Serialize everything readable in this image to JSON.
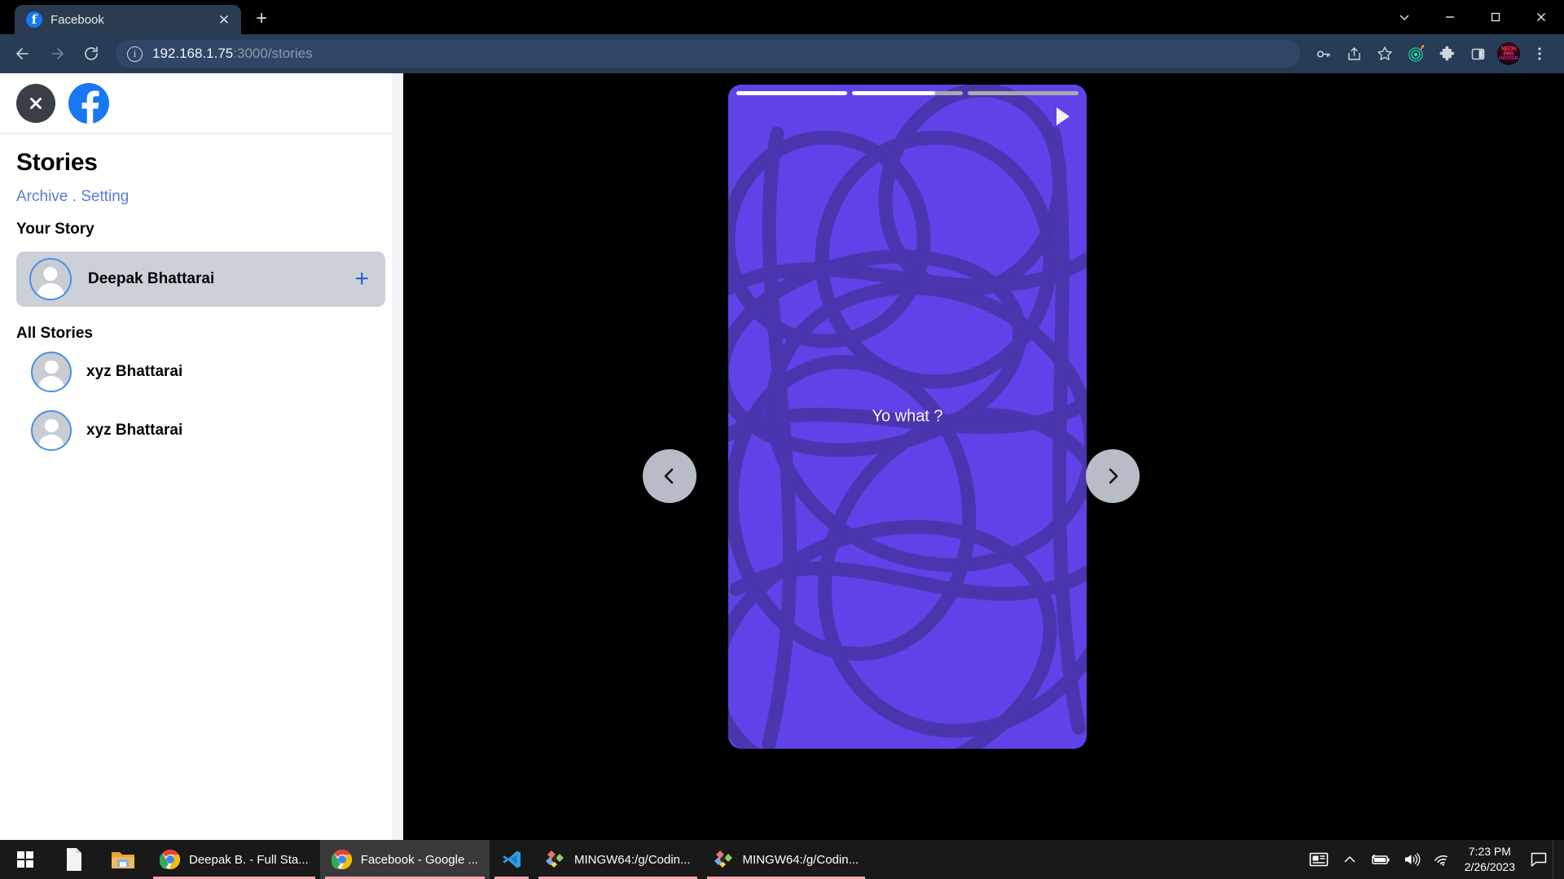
{
  "browser": {
    "tab": {
      "title": "Facebook",
      "favicon": "facebook-icon",
      "close": "✕"
    },
    "new_tab_label": "+",
    "window_controls": [
      {
        "name": "tab-search-button",
        "glyph": "∨"
      },
      {
        "name": "minimize-button",
        "glyph": "—"
      },
      {
        "name": "maximize-button",
        "glyph": "❐"
      },
      {
        "name": "close-window-button",
        "glyph": "✕"
      }
    ],
    "nav": {
      "back": "back-arrow-icon",
      "forward": "forward-arrow-icon",
      "reload": "reload-icon"
    },
    "omnibox": {
      "site_info_icon": "site-info-icon",
      "url_host": "192.168.1.75",
      "url_rest": ":3000/stories",
      "full_url": "192.168.1.75:3000/stories"
    },
    "toolbar_icons": [
      {
        "name": "password-key-icon"
      },
      {
        "name": "share-icon"
      },
      {
        "name": "bookmark-star-icon"
      },
      {
        "name": "extension-target-icon"
      },
      {
        "name": "extensions-puzzle-icon"
      },
      {
        "name": "sidepanel-icon"
      },
      {
        "name": "profile-avatar"
      },
      {
        "name": "chrome-menu-icon"
      }
    ]
  },
  "sidebar": {
    "close_label": "✕",
    "brand_icon": "facebook-logo-icon",
    "title": "Stories",
    "links": {
      "archive": "Archive",
      "separator": " . ",
      "setting": "Setting"
    },
    "your_story_heading": "Your Story",
    "your_story": {
      "name": "Deepak Bhattarai",
      "add_label": "+"
    },
    "all_stories_heading": "All Stories",
    "all_stories": [
      {
        "name": "xyz Bhattarai"
      },
      {
        "name": "xyz Bhattarai"
      }
    ]
  },
  "story_viewer": {
    "background_color": "#6142e8",
    "stroke_color": "#4a35ab",
    "text": "Yo what ?",
    "progress": [
      100,
      75,
      0
    ],
    "play_icon": "play-icon",
    "prev_label": "‹",
    "next_label": "›"
  },
  "taskbar": {
    "start_label": "start-icon",
    "pinned": [
      {
        "name": "file-explorer-doc-icon"
      },
      {
        "name": "file-explorer-icon"
      }
    ],
    "windows": [
      {
        "label": "Deepak B. - Full Sta...",
        "icon": "chrome-icon",
        "active": false
      },
      {
        "label": "Facebook - Google ...",
        "icon": "chrome-icon",
        "active": true
      },
      {
        "label": "",
        "icon": "vscode-icon",
        "active": false
      },
      {
        "label": "MINGW64:/g/Codin...",
        "icon": "gitbash-icon",
        "active": false
      },
      {
        "label": "MINGW64:/g/Codin...",
        "icon": "gitbash-icon",
        "active": false
      }
    ],
    "tray": [
      {
        "name": "news-weather-icon"
      },
      {
        "name": "show-hidden-icons-chevron"
      },
      {
        "name": "battery-charging-icon"
      },
      {
        "name": "volume-icon"
      },
      {
        "name": "wifi-icon"
      }
    ],
    "clock": {
      "time": "7:23 PM",
      "date": "2/26/2023"
    },
    "notification_icon": "action-center-icon"
  }
}
